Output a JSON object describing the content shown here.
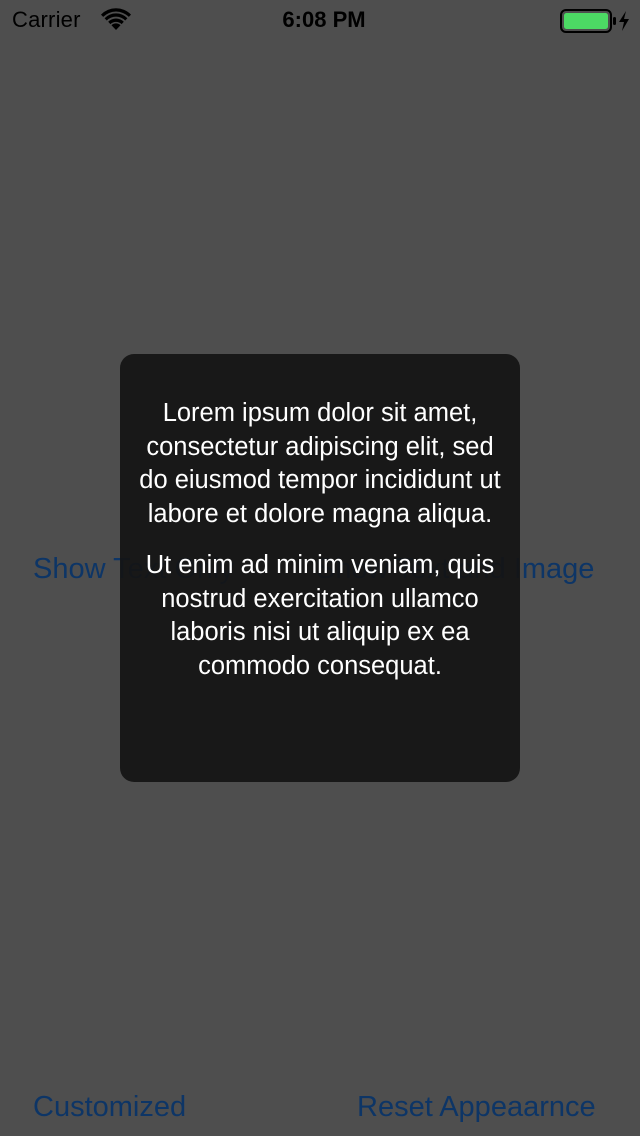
{
  "status_bar": {
    "carrier": "Carrier",
    "time": "6:08 PM",
    "wifi_icon": "wifi-icon",
    "battery_icon": "battery-charging-icon",
    "battery_color": "#4cd964"
  },
  "main": {
    "show_text_only_label": "Show Text Only",
    "show_text_and_image_label": "Show Text and Image",
    "customized_label": "Customized",
    "reset_appearance_label": "Reset Appeaarnce",
    "button_color": "#007aff"
  },
  "toast": {
    "paragraph_1": "Lorem ipsum dolor sit amet, consectetur adipiscing elit, sed do eiusmod tempor incididunt ut labore et dolore magna aliqua.",
    "paragraph_2": "Ut enim ad minim veniam, quis nostrud exercitation ullamco laboris nisi ut aliquip ex ea commodo consequat."
  }
}
